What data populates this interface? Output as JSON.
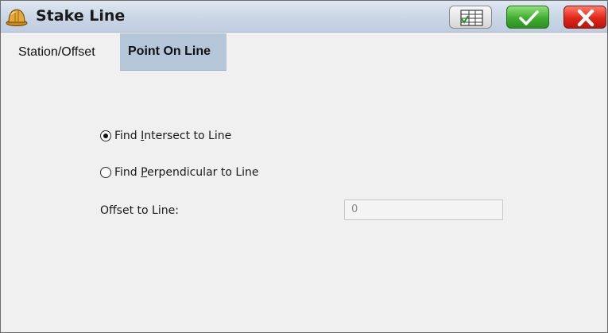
{
  "window": {
    "title": "Stake Line",
    "icon": "hard-hat-icon",
    "buttons": {
      "list_icon": "list-view-icon",
      "ok_icon": "checkmark-icon",
      "cancel_icon": "close-x-icon"
    },
    "colors": {
      "ok": "#3fae2f",
      "cancel": "#e0261a",
      "active_tab": "#b6c6d9"
    }
  },
  "tabs": [
    {
      "label": "Station/Offset",
      "active": false
    },
    {
      "label": "Point On Line",
      "active": true
    }
  ],
  "form": {
    "mode_options": [
      {
        "prefix": "Find ",
        "mnemonic": "I",
        "rest": "ntersect to Line",
        "selected": true
      },
      {
        "prefix": "Find ",
        "mnemonic": "P",
        "rest": "erpendicular to Line",
        "selected": false
      }
    ],
    "offset": {
      "label": "Offset to Line:",
      "value": "0"
    }
  }
}
